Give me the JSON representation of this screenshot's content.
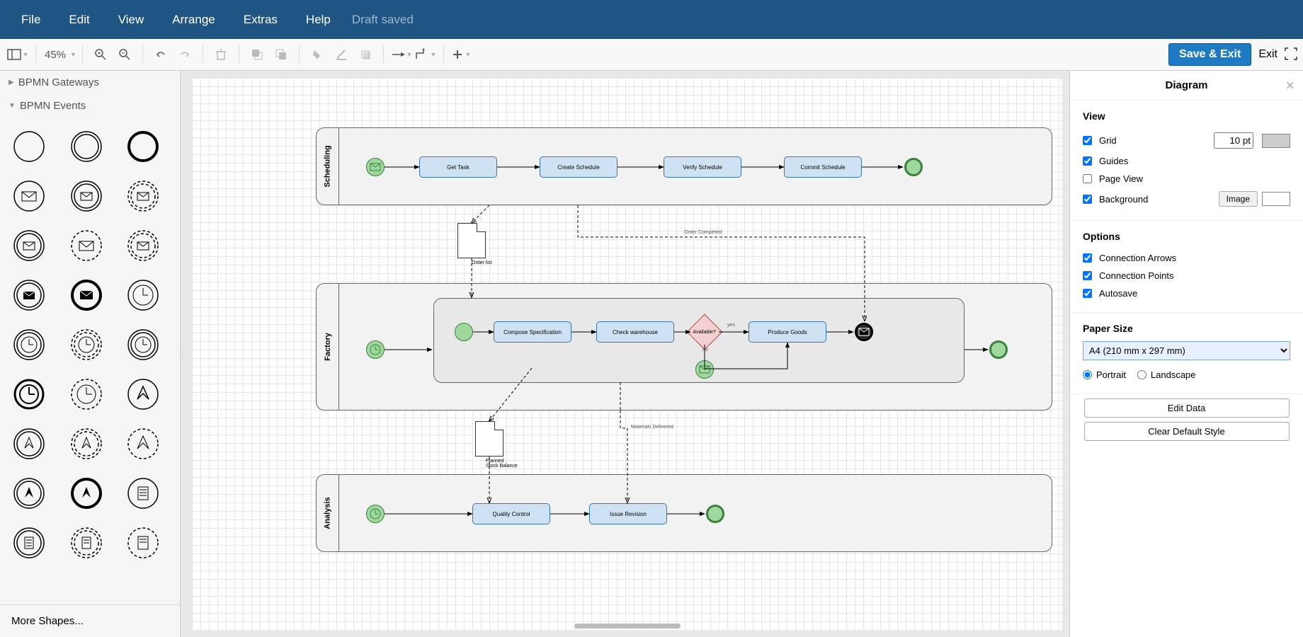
{
  "menus": [
    "File",
    "Edit",
    "View",
    "Arrange",
    "Extras",
    "Help"
  ],
  "draft_saved": "Draft saved",
  "toolbar": {
    "zoom": "45%",
    "save_exit": "Save & Exit",
    "exit": "Exit"
  },
  "sidebar": {
    "gateways_header": "BPMN Gateways",
    "events_header": "BPMN Events",
    "more_shapes": "More Shapes..."
  },
  "pools": {
    "scheduling": {
      "label": "Scheduling",
      "tasks": [
        "Get Task",
        "Create Schedule",
        "Verify Schedule",
        "Commit Schedule"
      ]
    },
    "factory": {
      "label": "Factory",
      "tasks": [
        "Compose Specification",
        "Check warehouse",
        "Produce Goods"
      ],
      "gateway": "Available?",
      "gateway_yes": "yes",
      "gateway_no": "no"
    },
    "analysis": {
      "label": "Analysis",
      "tasks": [
        "Quality Control",
        "Issue Revision"
      ]
    }
  },
  "docs": {
    "order_list": "Order list",
    "planned": "Planned\nStock Balance"
  },
  "flow_labels": {
    "order_completed": "Order Completed",
    "materials_delivered": "Materials Delivered"
  },
  "rpanel": {
    "title": "Diagram",
    "view_h": "View",
    "grid": "Grid",
    "grid_size": "10 pt",
    "guides": "Guides",
    "page_view": "Page View",
    "background": "Background",
    "image_btn": "Image",
    "options_h": "Options",
    "conn_arrows": "Connection Arrows",
    "conn_points": "Connection Points",
    "autosave": "Autosave",
    "paper_h": "Paper Size",
    "paper_size": "A4 (210 mm x 297 mm)",
    "portrait": "Portrait",
    "landscape": "Landscape",
    "edit_data": "Edit Data",
    "clear_style": "Clear Default Style"
  }
}
